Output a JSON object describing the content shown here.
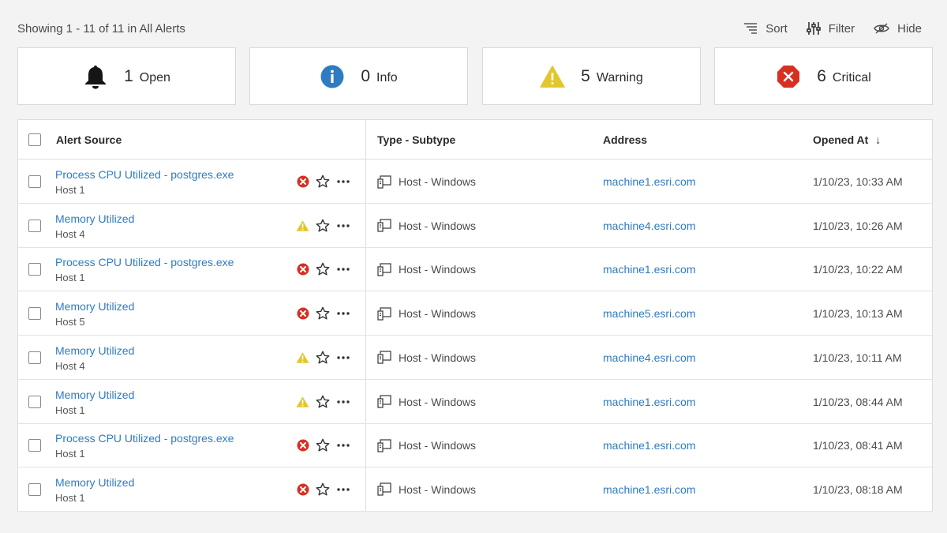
{
  "header": {
    "showing_text": "Showing 1 - 11 of 11 in All Alerts",
    "sort_label": "Sort",
    "filter_label": "Filter",
    "hide_label": "Hide"
  },
  "summary": [
    {
      "count": "1",
      "label": "Open",
      "icon": "bell-icon"
    },
    {
      "count": "0",
      "label": "Info",
      "icon": "info-icon",
      "color": "#2f7bc2"
    },
    {
      "count": "5",
      "label": "Warning",
      "icon": "warning-icon",
      "color": "#e2c72c"
    },
    {
      "count": "6",
      "label": "Critical",
      "icon": "critical-icon",
      "color": "#d83020"
    }
  ],
  "table": {
    "columns": {
      "source": "Alert Source",
      "type": "Type - Subtype",
      "address": "Address",
      "opened": "Opened At",
      "opened_sort_indicator": "↓"
    },
    "rows": [
      {
        "title": "Process CPU Utilized - postgres.exe",
        "host": "Host 1",
        "severity": "critical",
        "type": "Host - Windows",
        "address": "machine1.esri.com",
        "opened": "1/10/23, 10:33 AM"
      },
      {
        "title": "Memory Utilized",
        "host": "Host 4",
        "severity": "warning",
        "type": "Host - Windows",
        "address": "machine4.esri.com",
        "opened": "1/10/23, 10:26 AM"
      },
      {
        "title": "Process CPU Utilized - postgres.exe",
        "host": "Host 1",
        "severity": "critical",
        "type": "Host - Windows",
        "address": "machine1.esri.com",
        "opened": "1/10/23, 10:22 AM"
      },
      {
        "title": "Memory Utilized",
        "host": "Host 5",
        "severity": "critical",
        "type": "Host - Windows",
        "address": "machine5.esri.com",
        "opened": "1/10/23, 10:13 AM"
      },
      {
        "title": "Memory Utilized",
        "host": "Host 4",
        "severity": "warning",
        "type": "Host - Windows",
        "address": "machine4.esri.com",
        "opened": "1/10/23, 10:11 AM"
      },
      {
        "title": "Memory Utilized",
        "host": "Host 1",
        "severity": "warning",
        "type": "Host - Windows",
        "address": "machine1.esri.com",
        "opened": "1/10/23, 08:44 AM"
      },
      {
        "title": "Process CPU Utilized - postgres.exe",
        "host": "Host 1",
        "severity": "critical",
        "type": "Host - Windows",
        "address": "machine1.esri.com",
        "opened": "1/10/23, 08:41 AM"
      },
      {
        "title": "Memory Utilized",
        "host": "Host 1",
        "severity": "critical",
        "type": "Host - Windows",
        "address": "machine1.esri.com",
        "opened": "1/10/23, 08:18 AM"
      }
    ]
  },
  "colors": {
    "link": "#2f7bc2",
    "critical": "#d83020",
    "warning": "#e2c72c",
    "info": "#2f7bc2"
  }
}
